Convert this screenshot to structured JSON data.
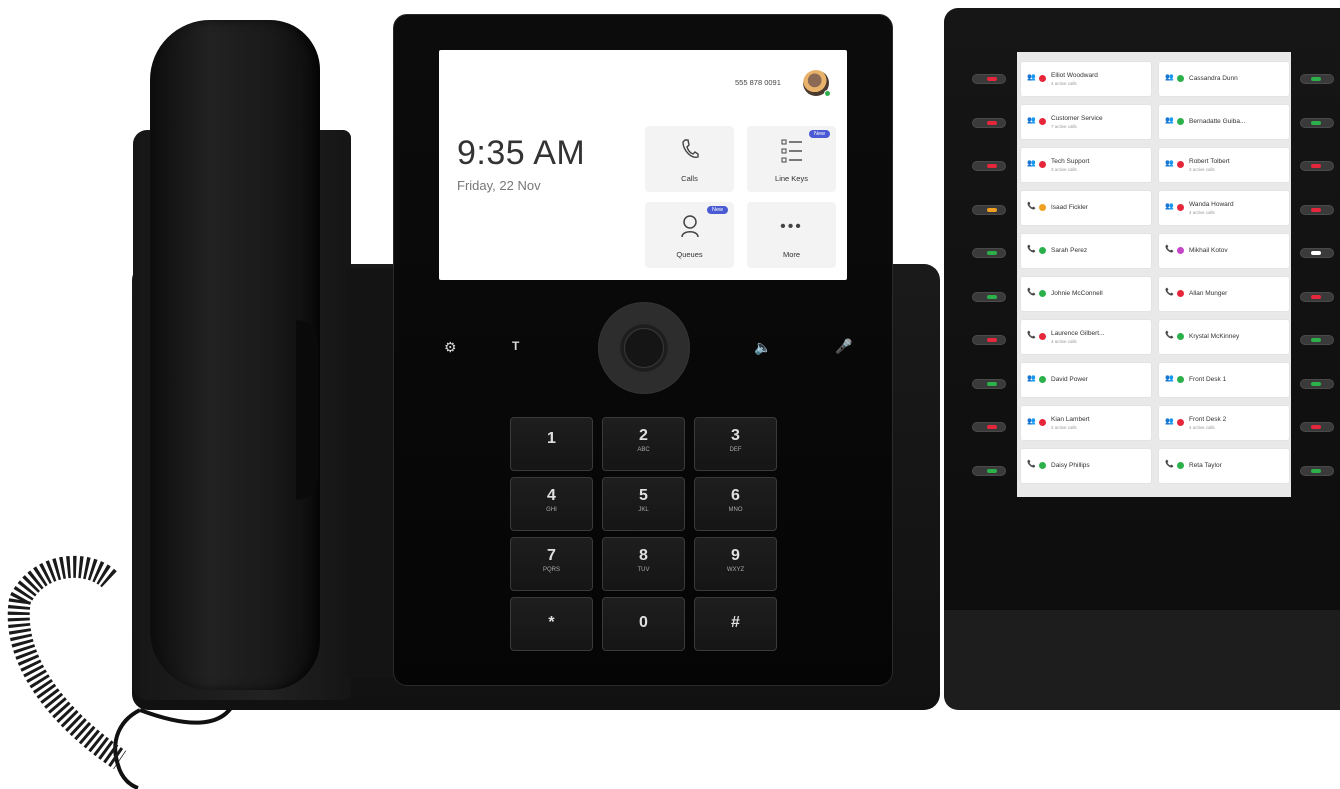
{
  "screen": {
    "phone_number": "555 878 0091",
    "time": "9:35 AM",
    "date": "Friday, 22 Nov",
    "tiles": [
      {
        "label": "Calls",
        "icon": "phone-icon",
        "badge": ""
      },
      {
        "label": "Line Keys",
        "icon": "line-keys-icon",
        "badge": "New"
      },
      {
        "label": "Queues",
        "icon": "queues-icon",
        "badge": "New"
      },
      {
        "label": "More",
        "icon": "more-icon",
        "badge": ""
      }
    ]
  },
  "hard_keys": [
    "settings-icon",
    "teams-icon",
    "volume-icon",
    "microphone-icon"
  ],
  "keypad": [
    {
      "digit": "1",
      "letters": ""
    },
    {
      "digit": "2",
      "letters": "ABC"
    },
    {
      "digit": "3",
      "letters": "DEF"
    },
    {
      "digit": "4",
      "letters": "GHI"
    },
    {
      "digit": "5",
      "letters": "JKL"
    },
    {
      "digit": "6",
      "letters": "MNO"
    },
    {
      "digit": "7",
      "letters": "PQRS"
    },
    {
      "digit": "8",
      "letters": "TUV"
    },
    {
      "digit": "9",
      "letters": "WXYZ"
    },
    {
      "digit": "*",
      "letters": ""
    },
    {
      "digit": "0",
      "letters": ""
    },
    {
      "digit": "#",
      "letters": ""
    }
  ],
  "module": {
    "lines": [
      {
        "name": "Elliot Woodward",
        "sub": "4 active calls",
        "type": "group",
        "status": "#e5263b"
      },
      {
        "name": "Cassandra Dunn",
        "sub": "",
        "type": "group",
        "status": "#2bb04a"
      },
      {
        "name": "Customer Service",
        "sub": "7 active calls",
        "type": "group",
        "status": "#e5263b"
      },
      {
        "name": "Bernadatte Guiba...",
        "sub": "",
        "type": "group",
        "status": "#2bb04a"
      },
      {
        "name": "Tech Support",
        "sub": "3 active calls",
        "type": "group",
        "status": "#e5263b"
      },
      {
        "name": "Robert Tolbert",
        "sub": "3 active calls",
        "type": "group",
        "status": "#e5263b"
      },
      {
        "name": "Isaad Fickler",
        "sub": "",
        "type": "phone",
        "status": "#f0a020"
      },
      {
        "name": "Wanda Howard",
        "sub": "4 active calls",
        "type": "group",
        "status": "#e5263b"
      },
      {
        "name": "Sarah Perez",
        "sub": "",
        "type": "phone",
        "status": "#2bb04a"
      },
      {
        "name": "Mikhail Kotov",
        "sub": "",
        "type": "phone",
        "status": "#c445c8"
      },
      {
        "name": "Johnie McConnell",
        "sub": "",
        "type": "phone",
        "status": "#2bb04a"
      },
      {
        "name": "Allan Munger",
        "sub": "",
        "type": "phone",
        "status": "#e5263b"
      },
      {
        "name": "Laurence Gilbert...",
        "sub": "4 active calls",
        "type": "phone",
        "status": "#e5263b"
      },
      {
        "name": "Krystal McKinney",
        "sub": "",
        "type": "phone",
        "status": "#2bb04a"
      },
      {
        "name": "David Power",
        "sub": "",
        "type": "group",
        "status": "#2bb04a"
      },
      {
        "name": "Front Desk 1",
        "sub": "",
        "type": "group",
        "status": "#2bb04a"
      },
      {
        "name": "Kian Lambert",
        "sub": "2 active calls",
        "type": "group",
        "status": "#e5263b"
      },
      {
        "name": "Front Desk 2",
        "sub": "4 active calls",
        "type": "group",
        "status": "#e5263b"
      },
      {
        "name": "Daisy Phillips",
        "sub": "",
        "type": "phone",
        "status": "#2bb04a"
      },
      {
        "name": "Reta Taylor",
        "sub": "",
        "type": "phone",
        "status": "#2bb04a"
      }
    ],
    "leds_left": [
      "#e5263b",
      "#e5263b",
      "#e5263b",
      "#f0a020",
      "#2bb04a",
      "#2bb04a",
      "#e5263b",
      "#2bb04a",
      "#e5263b",
      "#2bb04a"
    ],
    "leds_right": [
      "#2bb04a",
      "#2bb04a",
      "#e5263b",
      "#e5263b",
      "#ffffff",
      "#e5263b",
      "#2bb04a",
      "#2bb04a",
      "#e5263b",
      "#2bb04a"
    ]
  }
}
